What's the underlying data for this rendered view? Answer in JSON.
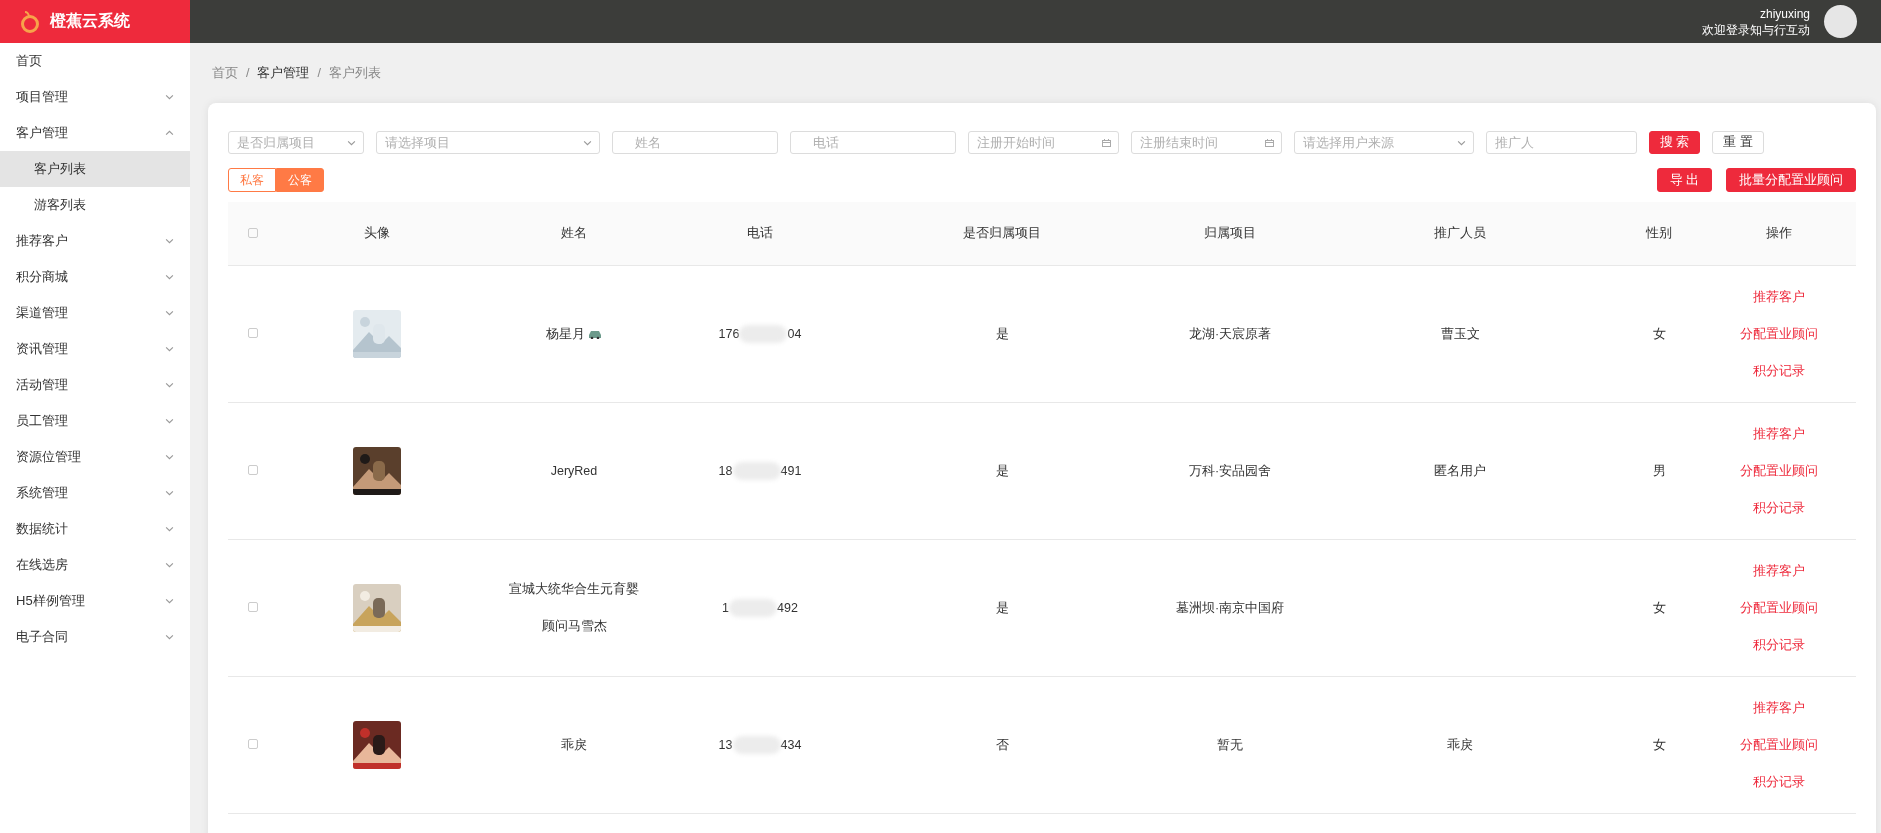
{
  "header": {
    "logo_text": "橙蕉云系统",
    "username": "zhiyuxing",
    "welcome": "欢迎登录知与行互动"
  },
  "sidebar": {
    "items": [
      {
        "label": "首页"
      },
      {
        "label": "项目管理",
        "expanded": false
      },
      {
        "label": "客户管理",
        "expanded": true,
        "children": [
          {
            "label": "客户列表",
            "selected": true
          },
          {
            "label": "游客列表",
            "selected": false
          }
        ]
      },
      {
        "label": "推荐客户",
        "expanded": false
      },
      {
        "label": "积分商城",
        "expanded": false
      },
      {
        "label": "渠道管理",
        "expanded": false
      },
      {
        "label": "资讯管理",
        "expanded": false
      },
      {
        "label": "活动管理",
        "expanded": false
      },
      {
        "label": "员工管理",
        "expanded": false
      },
      {
        "label": "资源位管理",
        "expanded": false
      },
      {
        "label": "系统管理",
        "expanded": false
      },
      {
        "label": "数据统计",
        "expanded": false
      },
      {
        "label": "在线选房",
        "expanded": false
      },
      {
        "label": "H5样例管理",
        "expanded": false
      },
      {
        "label": "电子合同",
        "expanded": false
      }
    ]
  },
  "breadcrumb": [
    {
      "label": "首页",
      "current": false
    },
    {
      "separator": "/",
      "label": "客户管理",
      "current": true
    },
    {
      "separator": "/",
      "label": "客户列表",
      "current": false
    }
  ],
  "filters": [
    {
      "kind": "select",
      "placeholder": "是否归属项目"
    },
    {
      "kind": "select",
      "placeholder": "请选择项目"
    },
    {
      "kind": "input",
      "placeholder": "姓名"
    },
    {
      "kind": "input",
      "placeholder": "电话"
    },
    {
      "kind": "date",
      "placeholder": "注册开始时间"
    },
    {
      "kind": "date",
      "placeholder": "注册结束时间"
    },
    {
      "kind": "select",
      "placeholder": "请选择用户来源"
    },
    {
      "kind": "input",
      "placeholder": "推广人"
    }
  ],
  "filter_buttons": [
    {
      "label": "搜 索",
      "primary": true
    },
    {
      "label": "重 置",
      "primary": false
    }
  ],
  "type_toggle": [
    {
      "label": "私客",
      "selected": false
    },
    {
      "label": "公客",
      "selected": true
    }
  ],
  "action_buttons": [
    "导 出",
    "批量分配置业顾问"
  ],
  "table": {
    "all_checked": false,
    "columns": [
      "头像",
      "姓名",
      "电话",
      "是否归属项目",
      "归属项目",
      "推广人员",
      "性别",
      "操作"
    ],
    "rows": [
      {
        "checked": false,
        "avatar": {
          "kind": "picture"
        },
        "name": [
          "杨星月"
        ],
        "name_icon": {
          "kind": "car"
        },
        "phone_prefix": "176",
        "phone_suffix": "04",
        "belongs": "是",
        "project": "龙湖·天宸原著",
        "promoter": "曹玉文",
        "gender": "女",
        "actions": [
          "推荐客户",
          "分配置业顾问",
          "积分记录"
        ]
      },
      {
        "checked": false,
        "avatar": {
          "kind": "picture"
        },
        "name": [
          "JeryRed"
        ],
        "phone_prefix": "18",
        "phone_suffix": "491",
        "belongs": "是",
        "project": "万科·安品园舍",
        "promoter": "匿名用户",
        "gender": "男",
        "actions": [
          "推荐客户",
          "分配置业顾问",
          "积分记录"
        ]
      },
      {
        "checked": false,
        "avatar": {
          "kind": "picture"
        },
        "name": [
          "宣城大统华合生元育婴",
          "顾问马雪杰"
        ],
        "phone_prefix": "1",
        "phone_suffix": "492",
        "belongs": "是",
        "project": "墓洲坝·南京中国府",
        "gender": "女",
        "actions": [
          "推荐客户",
          "分配置业顾问",
          "积分记录"
        ]
      },
      {
        "checked": false,
        "avatar": {
          "kind": "picture"
        },
        "name": [
          "乖戾"
        ],
        "phone_prefix": "13",
        "phone_suffix": "434",
        "belongs": "否",
        "project": "暂无",
        "promoter": "乖戾",
        "gender": "女",
        "actions": [
          "推荐客户",
          "分配置业顾问",
          "积分记录"
        ]
      }
    ]
  }
}
